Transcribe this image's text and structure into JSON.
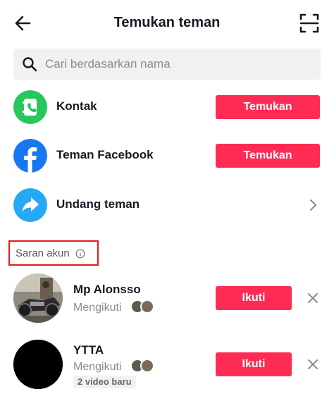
{
  "header": {
    "title": "Temukan teman",
    "back_icon": "arrow-left-icon",
    "scan_icon": "qr-scan-icon"
  },
  "search": {
    "placeholder": "Cari berdasarkan nama",
    "icon": "search-icon"
  },
  "options": [
    {
      "label": "Kontak",
      "icon": "contact-book-icon",
      "icon_color": "#26c75d",
      "action": "Temukan"
    },
    {
      "label": "Teman Facebook",
      "icon": "facebook-icon",
      "icon_color": "#1877f2",
      "action": "Temukan"
    },
    {
      "label": "Undang teman",
      "icon": "share-arrow-icon",
      "icon_color": "#26a9f5",
      "action": "chevron-right-icon"
    }
  ],
  "suggestions": {
    "title": "Saran akun",
    "info_icon": "info-icon",
    "users": [
      {
        "name": "Mp Alonsso",
        "status": "Mengikuti",
        "action": "Ikuti",
        "avatar": "motorcycle-photo"
      },
      {
        "name": "YTTA",
        "status": "Mengikuti",
        "badge": "2 video baru",
        "action": "Ikuti",
        "avatar": "black-avatar"
      }
    ]
  },
  "colors": {
    "accent": "#fe2c55",
    "highlight_border": "#e21b1b"
  }
}
